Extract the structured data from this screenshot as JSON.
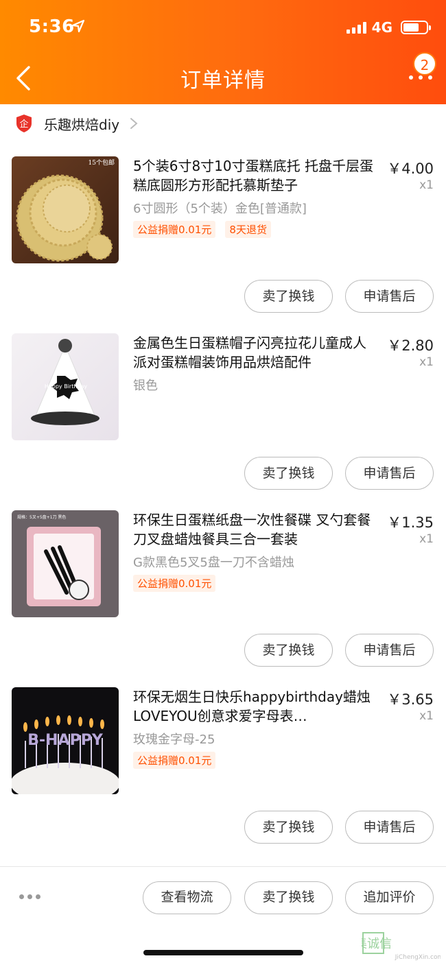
{
  "status_bar": {
    "time": "5:36",
    "network": "4G"
  },
  "header": {
    "title": "订单详情",
    "badge_count": "2"
  },
  "shop": {
    "name": "乐趣烘焙diy"
  },
  "items": [
    {
      "title": "5个装6寸8寸10寸蛋糕底托 托盘千层蛋糕底圆形方形配托慕斯垫子",
      "price": "￥4.00",
      "qty": "x1",
      "spec": "6寸圆形（5个装）金色[普通款]",
      "tags": [
        "公益捐赠0.01元",
        "8天退货"
      ],
      "thumb_label": "15个包邮",
      "sell_label": "卖了换钱",
      "after_sale_label": "申请售后"
    },
    {
      "title": "金属色生日蛋糕帽子闪亮拉花儿童成人派对蛋糕帽装饰用品烘焙配件",
      "price": "￥2.80",
      "qty": "x1",
      "spec": "银色",
      "tags": [],
      "thumb_label": "Happy Birthday",
      "sell_label": "卖了换钱",
      "after_sale_label": "申请售后"
    },
    {
      "title": "环保生日蛋糕纸盘一次性餐碟 叉勺套餐 刀叉盘蜡烛餐具三合一套装",
      "price": "￥1.35",
      "qty": "x1",
      "spec": "G款黑色5叉5盘一刀不含蜡烛",
      "tags": [
        "公益捐赠0.01元"
      ],
      "thumb_label": "规格：5叉+5盘+1刀 黑色",
      "sell_label": "卖了换钱",
      "after_sale_label": "申请售后"
    },
    {
      "title": "环保无烟生日快乐happybirthday蜡烛LOVEYOU创意求爱字母表…",
      "price": "￥3.65",
      "qty": "x1",
      "spec": "玫瑰金字母-25",
      "tags": [
        "公益捐赠0.01元"
      ],
      "thumb_label": "B-HAPPY",
      "sell_label": "卖了换钱",
      "after_sale_label": "申请售后"
    }
  ],
  "bottom_bar": {
    "logistics_label": "查看物流",
    "sell_label": "卖了换钱",
    "review_label": "追加评价"
  },
  "watermark": {
    "main": "集诚信",
    "sub": "JiChengXin.com"
  },
  "colors": {
    "accent": "#ff5a0c",
    "tag_bg": "#fff1e8",
    "tag_text": "#ff5000"
  }
}
